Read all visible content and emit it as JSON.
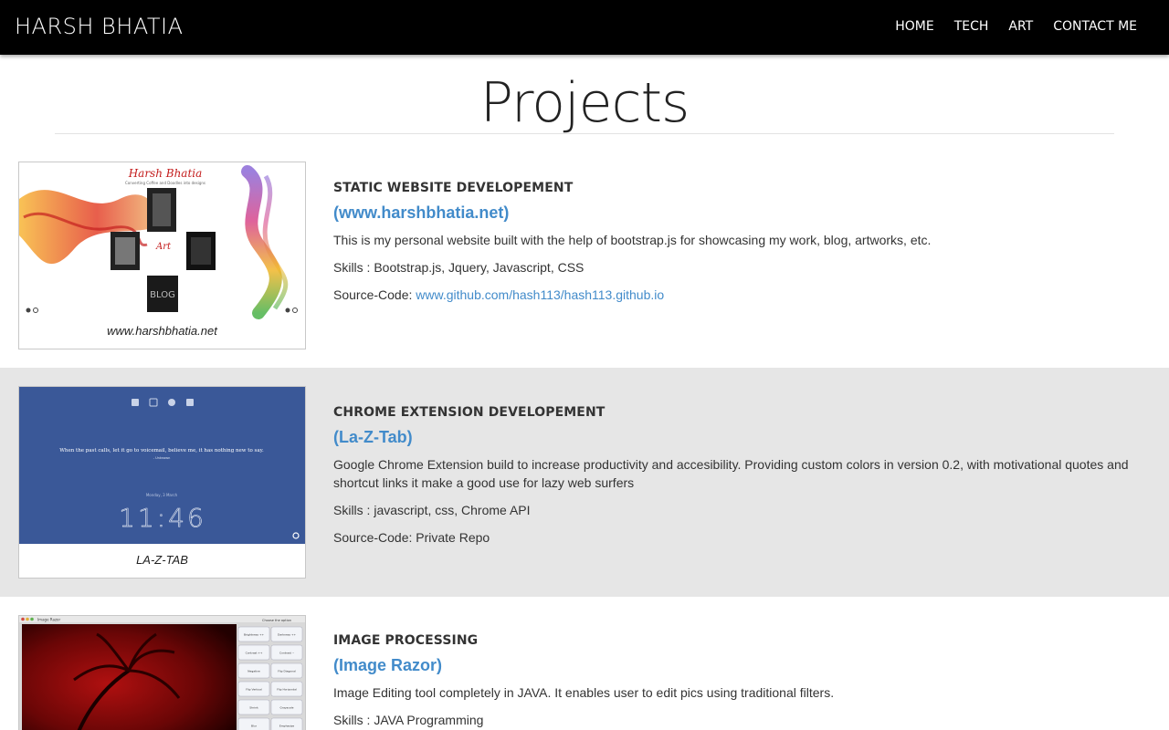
{
  "nav": {
    "brand": "HARSH BHATIA",
    "items": [
      "HOME",
      "TECH",
      "ART",
      "CONTACT ME"
    ]
  },
  "page": {
    "title": "Projects"
  },
  "projects": [
    {
      "title": "STATIC WEBSITE DEVELOPEMENT",
      "link": "(www.harshbhatia.net)",
      "description": "This is my personal website built with the help of bootstrap.js for showcasing my work, blog, artworks, etc.",
      "skills": "Skills : Bootstrap.js, Jquery, Javascript, CSS",
      "source_label": "Source-Code: ",
      "source_link": "www.github.com/hash113/hash113.github.io",
      "caption": "www.harshbhatia.net",
      "thumb": {
        "logo": "Harsh Bhatia",
        "tagline": "Converting Coffee and Doodles into designs",
        "art": "Art",
        "blog": "BLOG"
      }
    },
    {
      "title": "CHROME EXTENSION DEVELOPEMENT",
      "link": "(La-Z-Tab)",
      "description": "Google Chrome Extension build to increase productivity and accesibility. Providing custom colors in version 0.2, with motivational quotes and shortcut links it make a good use for lazy web surfers",
      "skills": "Skills : javascript, css, Chrome API",
      "source": "Source-Code: Private Repo",
      "caption": "LA-Z-TAB",
      "thumb": {
        "quote": "When the past calls, let it go to voicemail, believe me, it has nothing new to say.",
        "quote_author": "- Unknown",
        "date": "Monday, 3 March",
        "time": "11:46",
        "bg_color": "#3a5898"
      }
    },
    {
      "title": "IMAGE PROCESSING",
      "link": "(Image Razor)",
      "description": "Image Editing tool completely in JAVA. It enables user to edit pics using traditional filters.",
      "skills": "Skills : JAVA Programming",
      "thumb": {
        "window_title": "Image Razor",
        "panel_title": "Choose the option",
        "buttons": [
          "Brightness ++",
          "Darkness ++",
          "Contrast ++",
          "Contrast --",
          "Negative",
          "Flip Diagonal",
          "Flip Vertical",
          "Flip Horizontal",
          "Shrink",
          "Grayscale",
          "Blur",
          "Emphasize"
        ]
      }
    }
  ],
  "colors": {
    "link": "#428bca",
    "navbar": "#000000",
    "alt_row": "#e6e6e6"
  }
}
